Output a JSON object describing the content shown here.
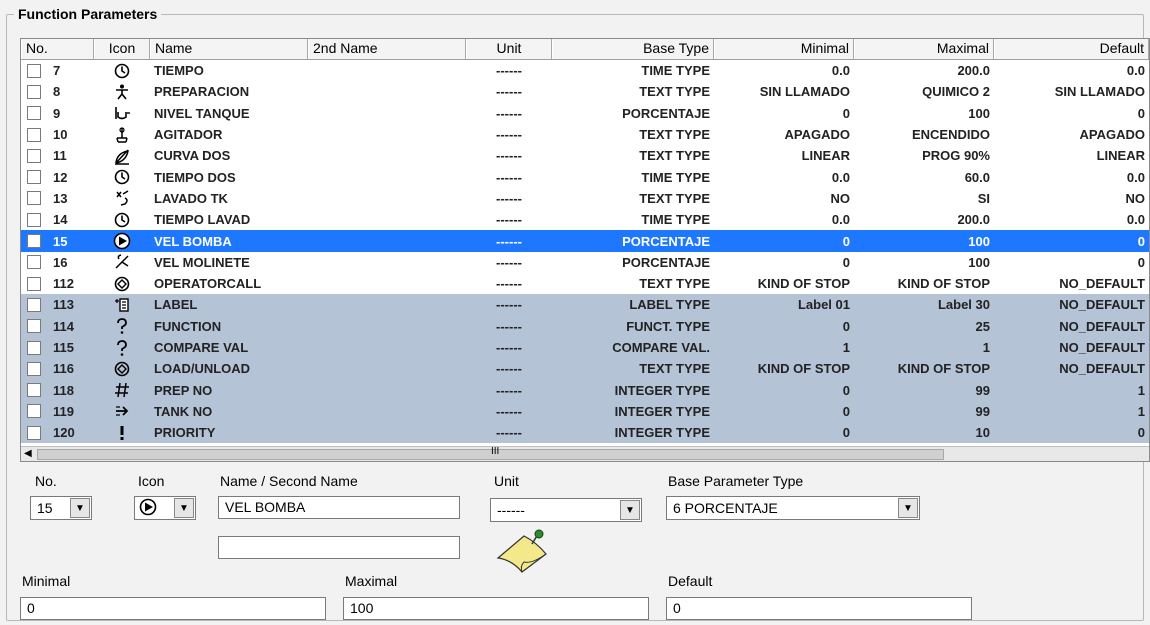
{
  "group_title": "Function Parameters",
  "columns": [
    "No.",
    "Icon",
    "Name",
    "2nd Name",
    "Unit",
    "Base Type",
    "Minimal",
    "Maximal",
    "Default"
  ],
  "rows": [
    {
      "no": "7",
      "icon": "clock-icon",
      "name": "TIEMPO",
      "second": "",
      "unit": "------",
      "base": "TIME TYPE",
      "min": "0.0",
      "max": "200.0",
      "def": "0.0",
      "style": "normal"
    },
    {
      "no": "8",
      "icon": "person-icon",
      "name": "PREPARACION",
      "second": "",
      "unit": "------",
      "base": "TEXT TYPE",
      "min": "SIN LLAMADO",
      "max": "QUIMICO 2",
      "def": "SIN LLAMADO",
      "style": "normal"
    },
    {
      "no": "9",
      "icon": "tank-icon",
      "name": "NIVEL TANQUE",
      "second": "",
      "unit": "------",
      "base": "PORCENTAJE",
      "min": "0",
      "max": "100",
      "def": "0",
      "style": "normal"
    },
    {
      "no": "10",
      "icon": "agitator-icon",
      "name": "AGITADOR",
      "second": "",
      "unit": "------",
      "base": "TEXT TYPE",
      "min": "APAGADO",
      "max": "ENCENDIDO",
      "def": "APAGADO",
      "style": "normal"
    },
    {
      "no": "11",
      "icon": "curve-icon",
      "name": "CURVA DOS",
      "second": "",
      "unit": "------",
      "base": "TEXT TYPE",
      "min": "LINEAR",
      "max": "PROG 90%",
      "def": "LINEAR",
      "style": "normal"
    },
    {
      "no": "12",
      "icon": "clock-icon",
      "name": "TIEMPO DOS",
      "second": "",
      "unit": "------",
      "base": "TIME TYPE",
      "min": "0.0",
      "max": "60.0",
      "def": "0.0",
      "style": "normal"
    },
    {
      "no": "13",
      "icon": "wash-icon",
      "name": "LAVADO TK",
      "second": "",
      "unit": "------",
      "base": "TEXT TYPE",
      "min": "NO",
      "max": "SI",
      "def": "NO",
      "style": "normal"
    },
    {
      "no": "14",
      "icon": "clock-icon",
      "name": "TIEMPO LAVAD",
      "second": "",
      "unit": "------",
      "base": "TIME TYPE",
      "min": "0.0",
      "max": "200.0",
      "def": "0.0",
      "style": "normal"
    },
    {
      "no": "15",
      "icon": "pump-icon",
      "name": "VEL BOMBA",
      "second": "",
      "unit": "------",
      "base": "PORCENTAJE",
      "min": "0",
      "max": "100",
      "def": "0",
      "style": "sel"
    },
    {
      "no": "16",
      "icon": "fan-icon",
      "name": "VEL MOLINETE",
      "second": "",
      "unit": "------",
      "base": "PORCENTAJE",
      "min": "0",
      "max": "100",
      "def": "0",
      "style": "normal"
    },
    {
      "no": "112",
      "icon": "hand-icon",
      "name": "OPERATORCALL",
      "second": "",
      "unit": "------",
      "base": "TEXT TYPE",
      "min": "KIND OF STOP",
      "max": "KIND OF STOP",
      "def": "NO_DEFAULT",
      "style": "normal"
    },
    {
      "no": "113",
      "icon": "label-icon",
      "name": "LABEL",
      "second": "",
      "unit": "------",
      "base": "LABEL TYPE",
      "min": "Label 01",
      "max": "Label 30",
      "def": "NO_DEFAULT",
      "style": "alt"
    },
    {
      "no": "114",
      "icon": "question-icon",
      "name": "FUNCTION",
      "second": "",
      "unit": "------",
      "base": "FUNCT. TYPE",
      "min": "0",
      "max": "25",
      "def": "NO_DEFAULT",
      "style": "alt"
    },
    {
      "no": "115",
      "icon": "question-icon",
      "name": "COMPARE VAL",
      "second": "",
      "unit": "------",
      "base": "COMPARE VAL.",
      "min": "1",
      "max": "1",
      "def": "NO_DEFAULT",
      "style": "alt"
    },
    {
      "no": "116",
      "icon": "hand-icon",
      "name": "LOAD/UNLOAD",
      "second": "",
      "unit": "------",
      "base": "TEXT TYPE",
      "min": "KIND OF STOP",
      "max": "KIND OF STOP",
      "def": "NO_DEFAULT",
      "style": "alt"
    },
    {
      "no": "118",
      "icon": "hash-icon",
      "name": "PREP NO",
      "second": "",
      "unit": "------",
      "base": "INTEGER TYPE",
      "min": "0",
      "max": "99",
      "def": "1",
      "style": "alt"
    },
    {
      "no": "119",
      "icon": "arrow-right-icon",
      "name": "TANK NO",
      "second": "",
      "unit": "------",
      "base": "INTEGER TYPE",
      "min": "0",
      "max": "99",
      "def": "1",
      "style": "alt"
    },
    {
      "no": "120",
      "icon": "exclamation-icon",
      "name": "PRIORITY",
      "second": "",
      "unit": "------",
      "base": "INTEGER TYPE",
      "min": "0",
      "max": "10",
      "def": "0",
      "style": "alt"
    }
  ],
  "form": {
    "no_label": "No.",
    "no_value": "15",
    "icon_label": "Icon",
    "name_label": "Name / Second Name",
    "name_value": "VEL BOMBA",
    "second_name_value": "",
    "unit_label": "Unit",
    "unit_value": "------",
    "base_label": "Base Parameter Type",
    "base_value": "6 PORCENTAJE",
    "minimal_label": "Minimal",
    "minimal_value": "0",
    "maximal_label": "Maximal",
    "maximal_value": "100",
    "default_label": "Default",
    "default_value": "0"
  },
  "scroll_grip": "III",
  "colors": {
    "selected_row": "#1e78ff",
    "shaded_row": "#b5c3d6",
    "note_icon": "#f3e98a"
  }
}
